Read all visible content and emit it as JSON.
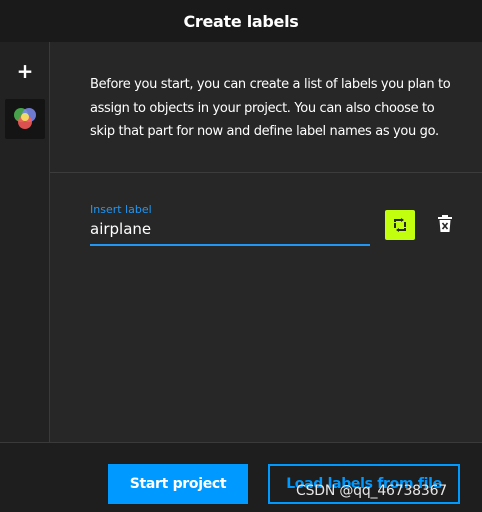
{
  "header": {
    "title": "Create labels"
  },
  "sidebar": {
    "add_icon": "plus-icon",
    "tile_icon": "color-circles-icon",
    "add_label": "+"
  },
  "intro": {
    "text": "Before you start, you can create a list of labels you plan to assign to objects in your project. You can also choose to skip that part for now and define label names as you go."
  },
  "label_entry": {
    "caption": "Insert label",
    "value": "airplane",
    "replace_icon": "replace-icon",
    "delete_icon": "trash-icon"
  },
  "footer": {
    "start_label": "Start project",
    "load_label": "Load labels from file"
  },
  "watermark": "CSDN @qq_46738367",
  "colors": {
    "accent": "#0099ff",
    "caption_blue": "#2196f3",
    "replace_green": "#c1ff0f",
    "header_bg": "#1a1a1a",
    "panel_bg": "#272727"
  }
}
